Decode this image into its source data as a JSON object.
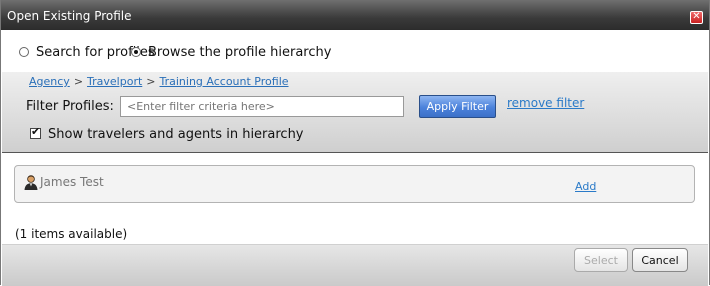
{
  "window": {
    "title": "Open Existing Profile",
    "close_glyph": "✕"
  },
  "search_mode": {
    "options": [
      {
        "label": "Search for profiles",
        "selected": false
      },
      {
        "label": "Browse the profile hierarchy",
        "selected": true
      }
    ]
  },
  "breadcrumb": {
    "items": [
      "Agency",
      "Travelport",
      "Training Account Profile"
    ],
    "separator": ">"
  },
  "filter": {
    "label": "Filter Profiles:",
    "placeholder": "<Enter filter criteria here>",
    "value": "",
    "apply_label": "Apply Filter",
    "remove_label": "remove filter"
  },
  "show_travelers": {
    "label": "Show travelers and agents in hierarchy",
    "checked": true
  },
  "results": {
    "rows": [
      {
        "name": "James Test",
        "icon": "person-icon",
        "action_label": "Add"
      }
    ],
    "count_text": "(1 items available)"
  },
  "footer": {
    "select_label": "Select",
    "cancel_label": "Cancel"
  },
  "colors": {
    "title_bar": "#3a3a3a",
    "link": "#2a6fb8",
    "apply_button": "#4b82db",
    "close_button": "#c82020"
  }
}
